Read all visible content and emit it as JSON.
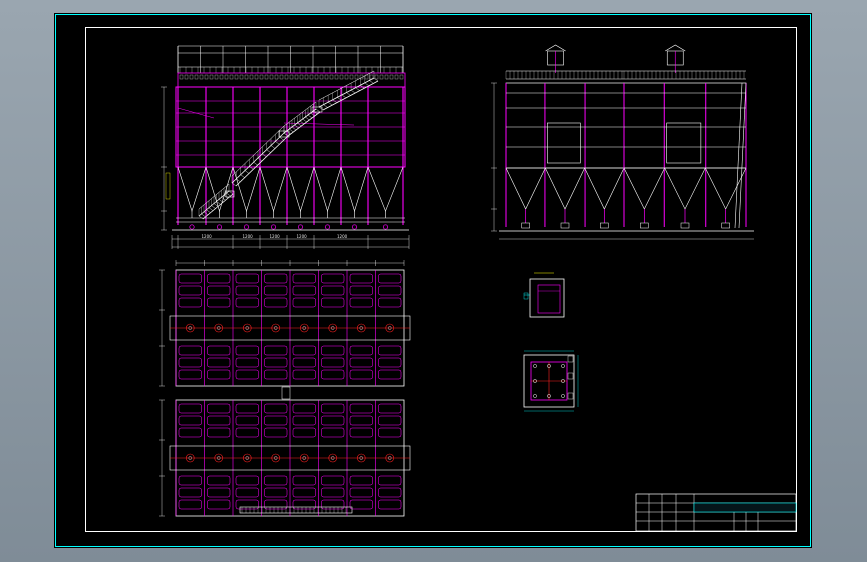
{
  "viewer": {
    "background_color": "#8d9aa5",
    "sheet_color": "#000000"
  },
  "colors": {
    "frame": "#ffffff",
    "inner_frame": "#00ffff",
    "structure": "#ff00ff",
    "outline": "#ffffff",
    "stair": "#ffffff",
    "notes": "#00ff00",
    "dimension": "#00ffff",
    "red": "#ff2020",
    "yellow": "#ffff00"
  },
  "drawing": {
    "front_elevation": {
      "bays": 6,
      "dims_bottom": [
        "",
        "1200",
        "1200",
        "1200",
        "1200",
        "1200",
        ""
      ],
      "total_dim": ""
    },
    "side_elevation": {
      "units": 2
    },
    "plan": {
      "modules": 2,
      "columns": 8
    },
    "detail_1": {
      "label": ""
    },
    "detail_2": {
      "label": ""
    },
    "notes": {
      "title": "",
      "lines": [
        "",
        "",
        "",
        "",
        "",
        "",
        "",
        "",
        "",
        "",
        "",
        ""
      ]
    },
    "title_block": {
      "drawing_title": "",
      "name": "",
      "rows": [
        "",
        "",
        "",
        ""
      ]
    }
  }
}
